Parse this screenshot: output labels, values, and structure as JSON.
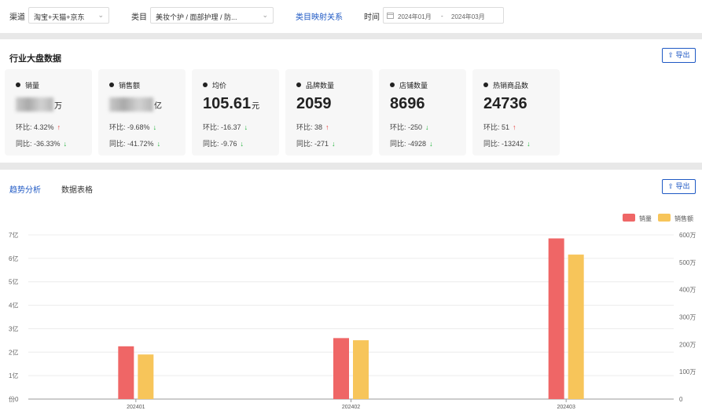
{
  "filters": {
    "channel_label": "渠道",
    "channel_value": "淘宝+天猫+京东",
    "category_label": "类目",
    "category_value": "美妆个护 / 面部护理 / 防...",
    "mapping_link": "类目映射关系",
    "time_label": "时间",
    "date_start": "2024年01月",
    "date_separator": "-",
    "date_end": "2024年03月"
  },
  "overview": {
    "title": "行业大盘数据",
    "export_label": "导出",
    "cards": [
      {
        "title": "销量",
        "value": "",
        "unit": "万",
        "value_blurred": true,
        "mom_label": "环比:",
        "mom": "4.32%",
        "mom_dir": "up",
        "yoy_label": "同比:",
        "yoy": "-36.33%",
        "yoy_dir": "down"
      },
      {
        "title": "销售额",
        "value": "",
        "unit": "亿",
        "value_blurred": true,
        "mom_label": "环比:",
        "mom": "-9.68%",
        "mom_dir": "down",
        "yoy_label": "同比:",
        "yoy": "-41.72%",
        "yoy_dir": "down"
      },
      {
        "title": "均价",
        "value": "105.61",
        "unit": "元",
        "mom_label": "环比:",
        "mom": "-16.37",
        "mom_dir": "down",
        "yoy_label": "同比:",
        "yoy": "-9.76",
        "yoy_dir": "down"
      },
      {
        "title": "品牌数量",
        "value": "2059",
        "unit": "",
        "mom_label": "环比:",
        "mom": "38",
        "mom_dir": "up",
        "yoy_label": "同比:",
        "yoy": "-271",
        "yoy_dir": "down"
      },
      {
        "title": "店铺数量",
        "value": "8696",
        "unit": "",
        "mom_label": "环比:",
        "mom": "-250",
        "mom_dir": "down",
        "yoy_label": "同比:",
        "yoy": "-4928",
        "yoy_dir": "down"
      },
      {
        "title": "热销商品数",
        "value": "24736",
        "unit": "",
        "mom_label": "环比:",
        "mom": "51",
        "mom_dir": "up",
        "yoy_label": "同比:",
        "yoy": "-13242",
        "yoy_dir": "down"
      }
    ]
  },
  "trend": {
    "tabs": [
      "趋势分析",
      "数据表格"
    ],
    "active_tab": 0,
    "export_label": "导出"
  },
  "colors": {
    "accent": "#1f59c4",
    "sales_volume": "#ef6666",
    "sales_amount": "#f7c55a",
    "up": "#e53935",
    "down": "#20b23a"
  },
  "chart_data": {
    "type": "bar",
    "categories": [
      "202401",
      "202402",
      "202403"
    ],
    "series": [
      {
        "name": "销量",
        "axis": "left",
        "values": [
          2.25,
          2.6,
          6.85
        ]
      },
      {
        "name": "销售额",
        "axis": "right",
        "values": [
          163,
          215,
          528
        ]
      }
    ],
    "left_axis": {
      "ticks": [
        "份0",
        "1亿",
        "2亿",
        "3亿",
        "4亿",
        "5亿",
        "6亿",
        "7亿"
      ],
      "range": [
        0,
        7
      ]
    },
    "right_axis": {
      "ticks": [
        "0",
        "100万",
        "200万",
        "300万",
        "400万",
        "500万",
        "600万"
      ],
      "range": [
        0,
        600
      ]
    },
    "legend_position": "top-right",
    "grid": true
  }
}
